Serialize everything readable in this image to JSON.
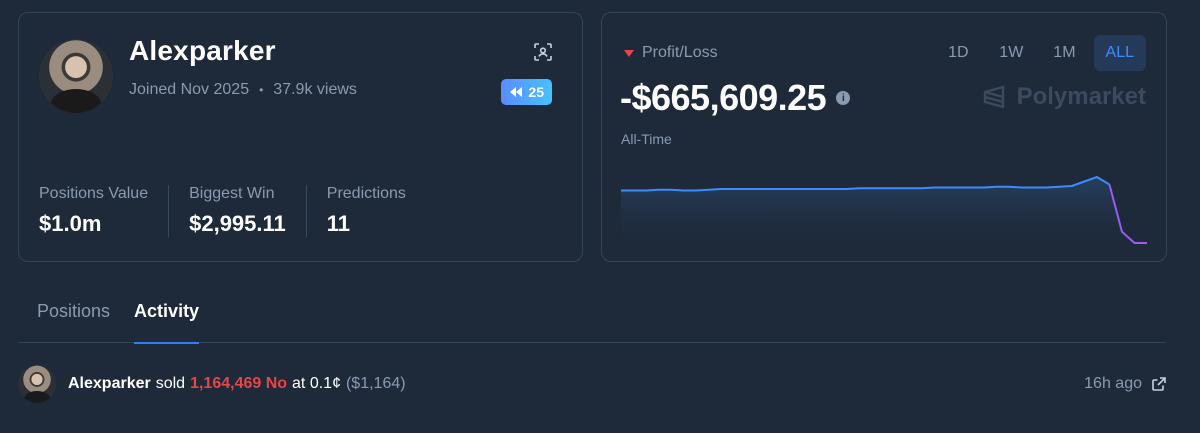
{
  "profile": {
    "username": "Alexparker",
    "joined": "Joined Nov 2025",
    "views": "37.9k views",
    "badge_count": "25",
    "stats": [
      {
        "label": "Positions Value",
        "value": "$1.0m"
      },
      {
        "label": "Biggest Win",
        "value": "$2,995.11"
      },
      {
        "label": "Predictions",
        "value": "11"
      }
    ]
  },
  "pnl": {
    "label": "Profit/Loss",
    "value": "-$665,609.25",
    "period_label": "All-Time",
    "ranges": [
      "1D",
      "1W",
      "1M",
      "ALL"
    ],
    "active_range": "ALL",
    "brand": "Polymarket"
  },
  "chart_data": {
    "type": "line",
    "title": "",
    "xlabel": "",
    "ylabel": "",
    "grid": false,
    "values": [
      0,
      0,
      0,
      1,
      1,
      0,
      0,
      1,
      2,
      2,
      2,
      2,
      2,
      2,
      2,
      2,
      2,
      2,
      2,
      3,
      3,
      3,
      3,
      3,
      3,
      4,
      4,
      4,
      4,
      4,
      5,
      5,
      4,
      4,
      4,
      5,
      6,
      12,
      18,
      8,
      -55,
      -70,
      -70
    ],
    "colors": {
      "line": "#3d8bff",
      "drop": "#9a5bf2"
    }
  },
  "tabs": [
    {
      "label": "Positions",
      "active": false
    },
    {
      "label": "Activity",
      "active": true
    }
  ],
  "activity": {
    "user": "Alexparker",
    "action": "sold",
    "quantity": "1,164,469 No",
    "price_text": "at 0.1¢",
    "usd": "($1,164)",
    "time": "16h ago"
  }
}
